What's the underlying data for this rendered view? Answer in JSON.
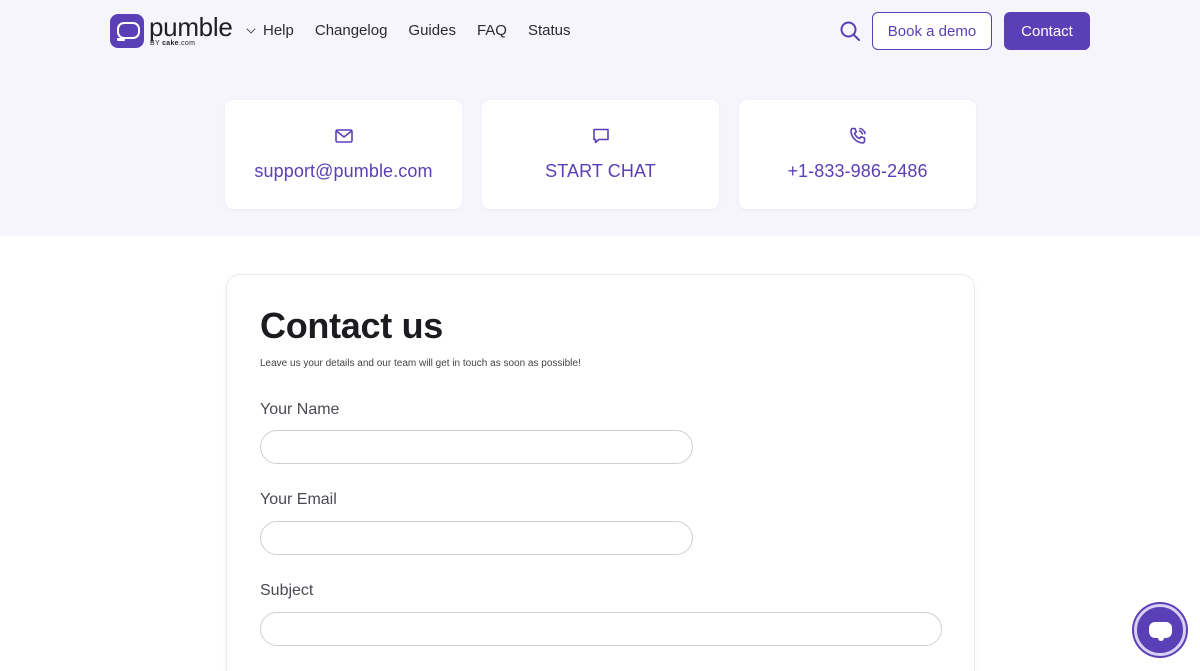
{
  "header": {
    "logo_word": "pumble",
    "logo_by": "BY",
    "logo_brand": "cake",
    "logo_suffix": ".com",
    "nav": [
      "Help",
      "Changelog",
      "Guides",
      "FAQ",
      "Status"
    ],
    "book_demo_label": "Book a demo",
    "contact_label": "Contact",
    "search_icon": "search-icon"
  },
  "cards": [
    {
      "icon": "mail-icon",
      "label": "support@pumble.com"
    },
    {
      "icon": "chat-icon",
      "label": "START CHAT"
    },
    {
      "icon": "phone-icon",
      "label": "+1-833-986-2486"
    }
  ],
  "form": {
    "title": "Contact us",
    "subtitle": "Leave us your details and our team will get in touch as soon as possible!",
    "fields": [
      {
        "label": "Your Name",
        "value": ""
      },
      {
        "label": "Your Email",
        "value": ""
      },
      {
        "label": "Subject",
        "value": ""
      }
    ]
  },
  "chat_widget": {
    "icon": "chat-bubble-icon"
  },
  "colors": {
    "accent": "#5b3fb6",
    "band": "#f7f5fc"
  }
}
